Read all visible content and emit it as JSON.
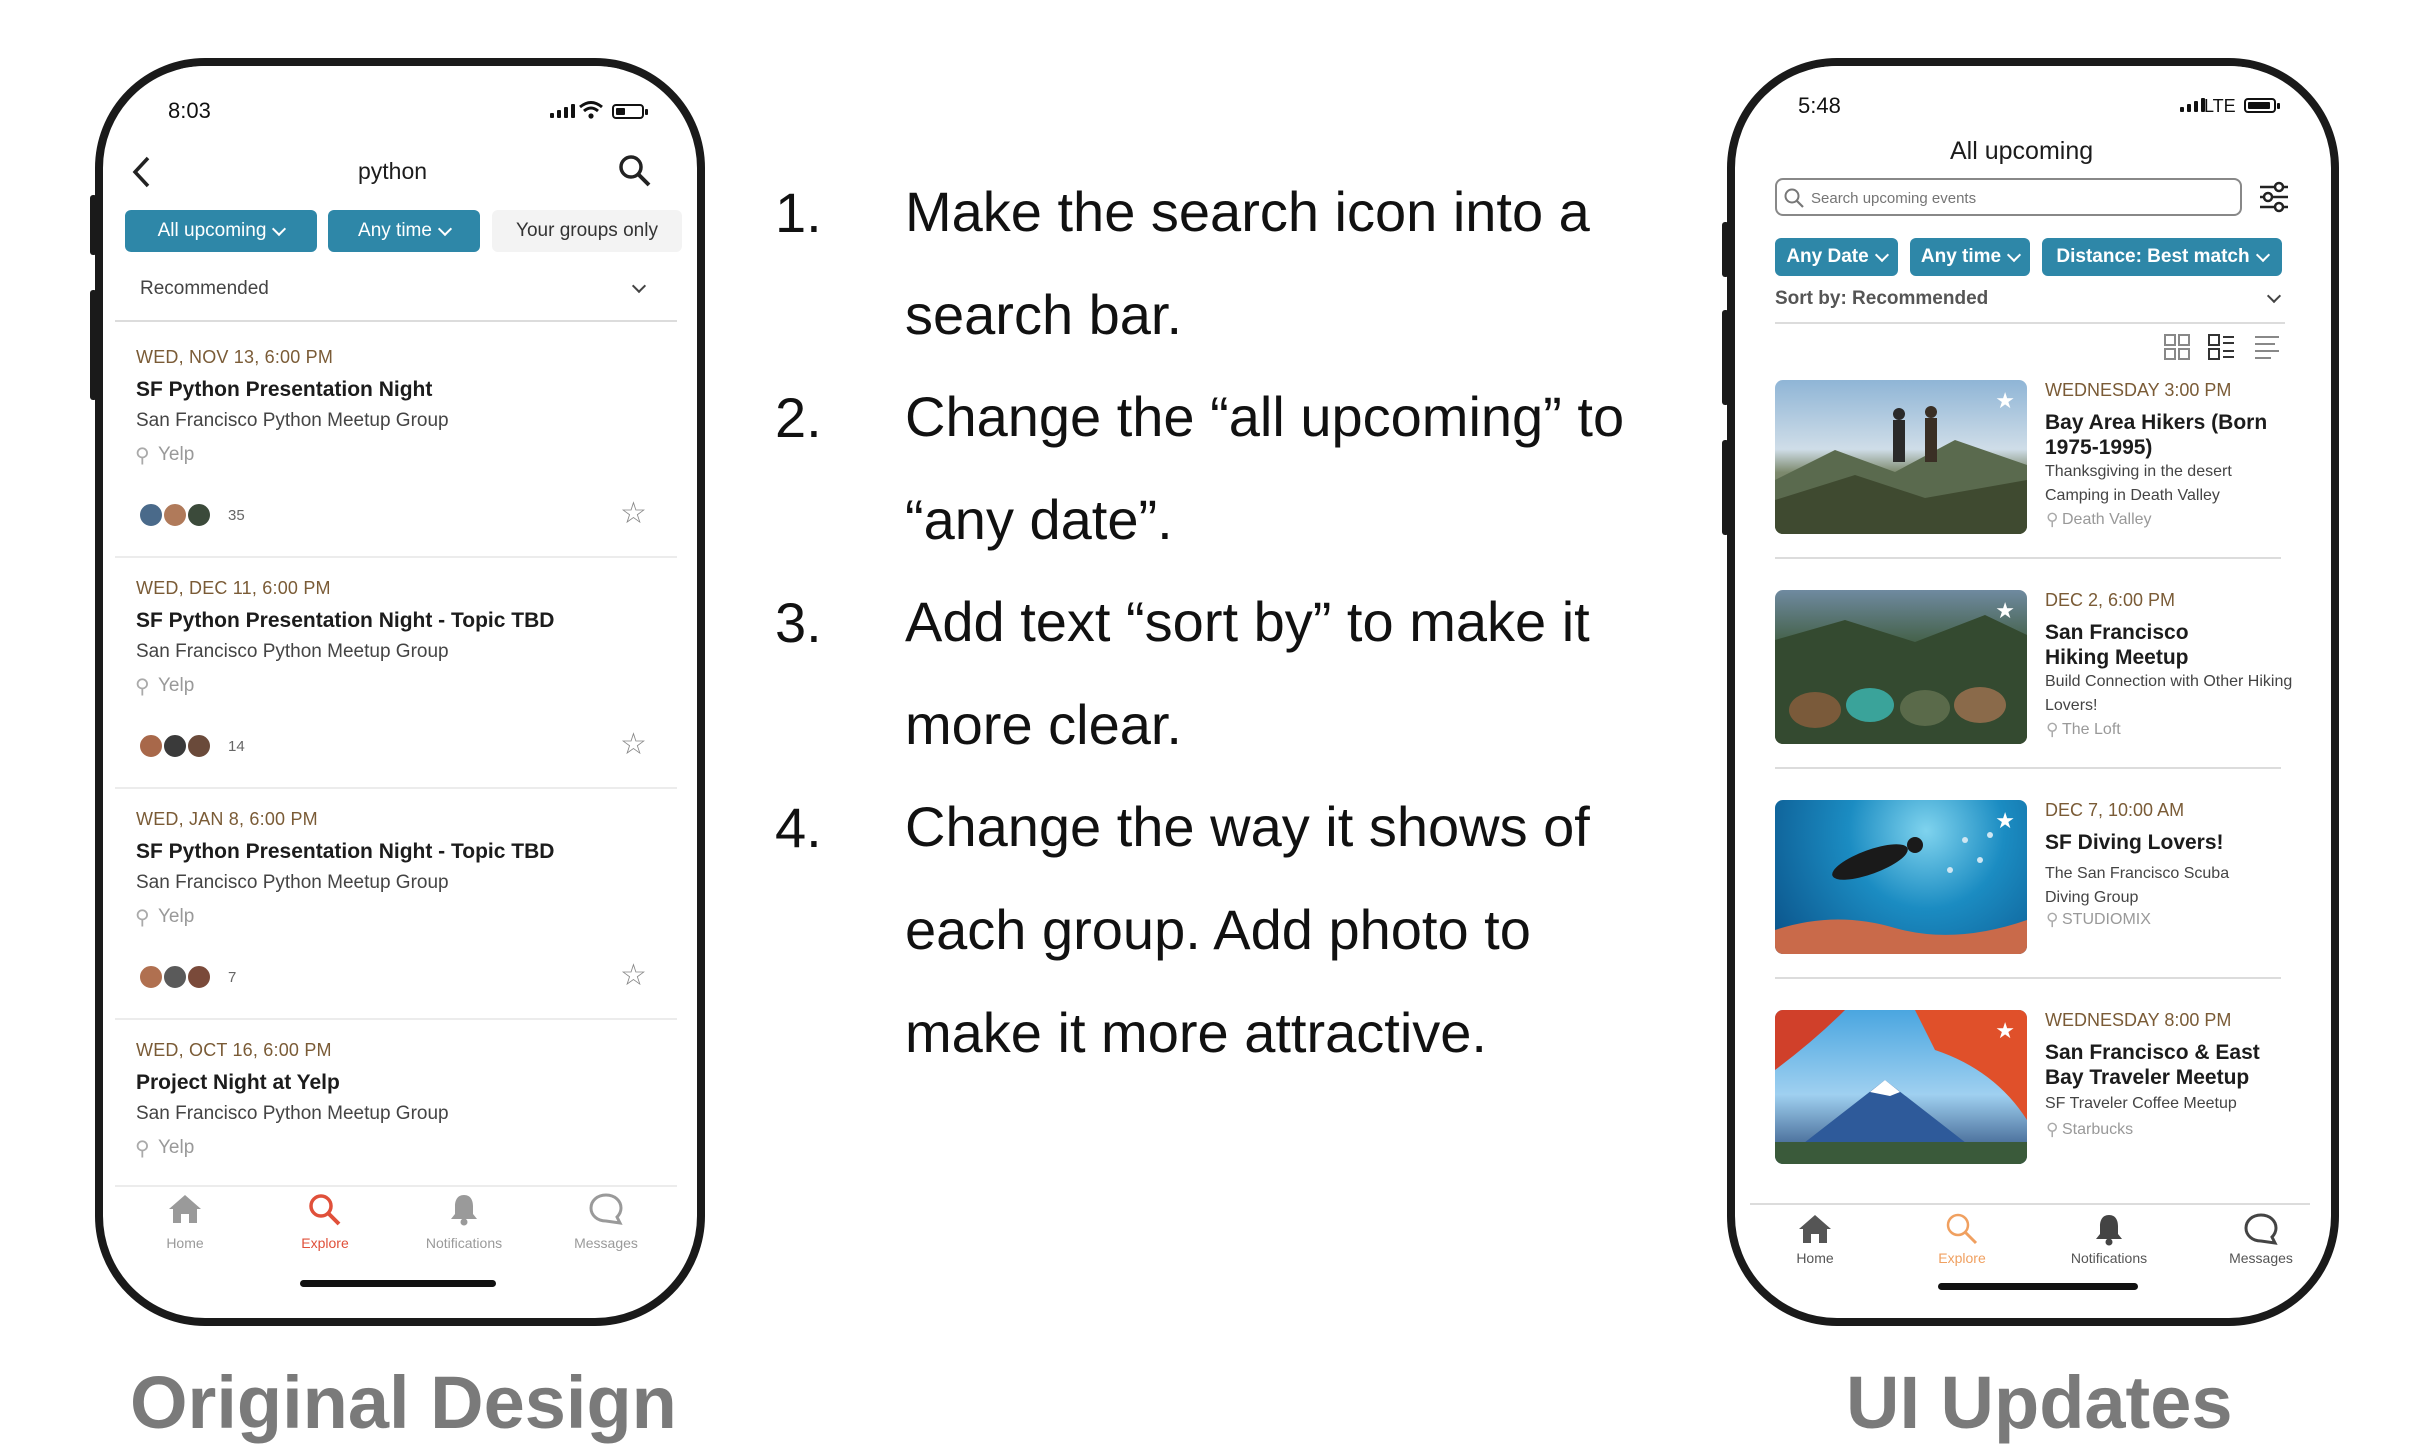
{
  "original": {
    "status_time": "8:03",
    "header_title": "python",
    "chips": [
      "All upcoming",
      "Any time",
      "Your groups only"
    ],
    "sort_label": "Recommended",
    "events": [
      {
        "date": "WED, NOV 13, 6:00 PM",
        "title": "SF Python Presentation Night",
        "group": "San Francisco Python Meetup Group",
        "location": "Yelp",
        "count": "35"
      },
      {
        "date": "WED, DEC 11, 6:00 PM",
        "title": "SF Python Presentation Night - Topic TBD",
        "group": "San Francisco Python Meetup Group",
        "location": "Yelp",
        "count": "14"
      },
      {
        "date": "WED, JAN 8, 6:00 PM",
        "title": "SF Python Presentation Night - Topic TBD",
        "group": "San Francisco Python Meetup Group",
        "location": "Yelp",
        "count": "7"
      },
      {
        "date": "WED, OCT 16, 6:00 PM",
        "title": "Project Night at Yelp",
        "group": "San Francisco Python Meetup Group",
        "location": "Yelp",
        "count": ""
      }
    ],
    "nav": [
      "Home",
      "Explore",
      "Notifications",
      "Messages"
    ],
    "caption": "Original Design"
  },
  "notes": {
    "items": [
      {
        "num": "1.",
        "text": "Make the search icon into a search bar."
      },
      {
        "num": "2.",
        "text": "Change the “all upcoming” to “any date”."
      },
      {
        "num": "3.",
        "text": "Add text “sort by” to make it more clear."
      },
      {
        "num": "4.",
        "text": "Change the way it shows of each group. Add photo to make it more attractive."
      }
    ]
  },
  "updated": {
    "status_time": "5:48",
    "network": "LTE",
    "header_title": "All upcoming",
    "search_placeholder": "Search upcoming events",
    "chips": [
      "Any Date",
      "Any time",
      "Distance: Best match"
    ],
    "sort_label": "Sort by: Recommended",
    "events": [
      {
        "date": "WEDNESDAY 3:00 PM",
        "title": "Bay Area Hikers (Born 1975-1995)",
        "group": "Thanksgiving in the desert Camping in Death Valley",
        "location": "Death Valley"
      },
      {
        "date": "DEC 2, 6:00 PM",
        "title": "San Francisco Hiking Meetup",
        "group": "Build Connection with Other Hiking Lovers!",
        "location": "The Loft"
      },
      {
        "date": "DEC 7, 10:00 AM",
        "title": "SF Diving Lovers!",
        "group": "The San Francisco Scuba Diving Group",
        "location": "STUDIOMIX"
      },
      {
        "date": "WEDNESDAY 8:00 PM",
        "title": "San Francisco & East Bay Traveler Meetup",
        "group": "SF Traveler Coffee Meetup",
        "location": "Starbucks"
      }
    ],
    "nav": [
      "Home",
      "Explore",
      "Notifications",
      "Messages"
    ],
    "caption": "UI Updates"
  },
  "colors": {
    "accent": "#2e87a8",
    "explore_active": "#e0503a",
    "date_brown": "#7a5b36",
    "caption_gray": "#7a7a7a"
  }
}
